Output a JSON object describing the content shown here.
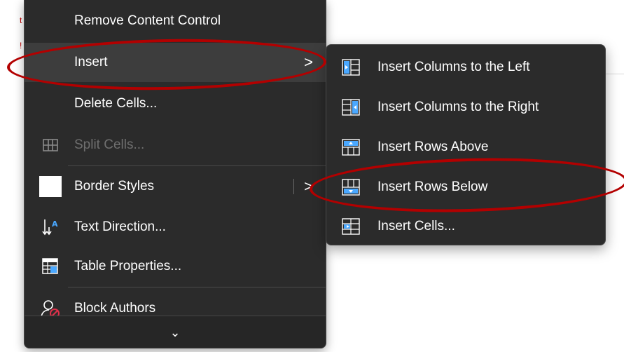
{
  "context_menu": {
    "items": [
      {
        "label": "Remove Content Control",
        "icon": "none"
      },
      {
        "label": "Insert",
        "icon": "none",
        "submenu": true,
        "highlighted": true
      },
      {
        "label": "Delete Cells...",
        "icon": "none"
      },
      {
        "label": "Split Cells...",
        "icon": "split-cells-icon",
        "disabled": true
      },
      {
        "label": "Border Styles",
        "icon": "border-styles-swatch-icon",
        "submenu": true
      },
      {
        "label": "Text Direction...",
        "icon": "text-direction-icon"
      },
      {
        "label": "Table Properties...",
        "icon": "table-properties-icon"
      },
      {
        "label": "Block Authors",
        "icon": "block-authors-icon"
      }
    ],
    "submenu_chevron": ">",
    "more_chevron": "⌄"
  },
  "insert_submenu": {
    "items": [
      {
        "label": "Insert Columns to the Left",
        "icon": "insert-columns-left-icon"
      },
      {
        "label": "Insert Columns to the Right",
        "icon": "insert-columns-right-icon"
      },
      {
        "label": "Insert Rows Above",
        "icon": "insert-rows-above-icon"
      },
      {
        "label": "Insert Rows Below",
        "icon": "insert-rows-below-icon"
      },
      {
        "label": "Insert Cells...",
        "icon": "insert-cells-icon"
      }
    ]
  },
  "annotations": {
    "circled": [
      "Insert",
      "Insert Rows Below"
    ],
    "color": "#b30000"
  },
  "colors": {
    "menu_bg": "#2b2b2b",
    "hover_bg": "#3d3d3d",
    "text": "#ffffff",
    "disabled_text": "#6f6f6f",
    "icon_accent": "#4aa8ff"
  }
}
